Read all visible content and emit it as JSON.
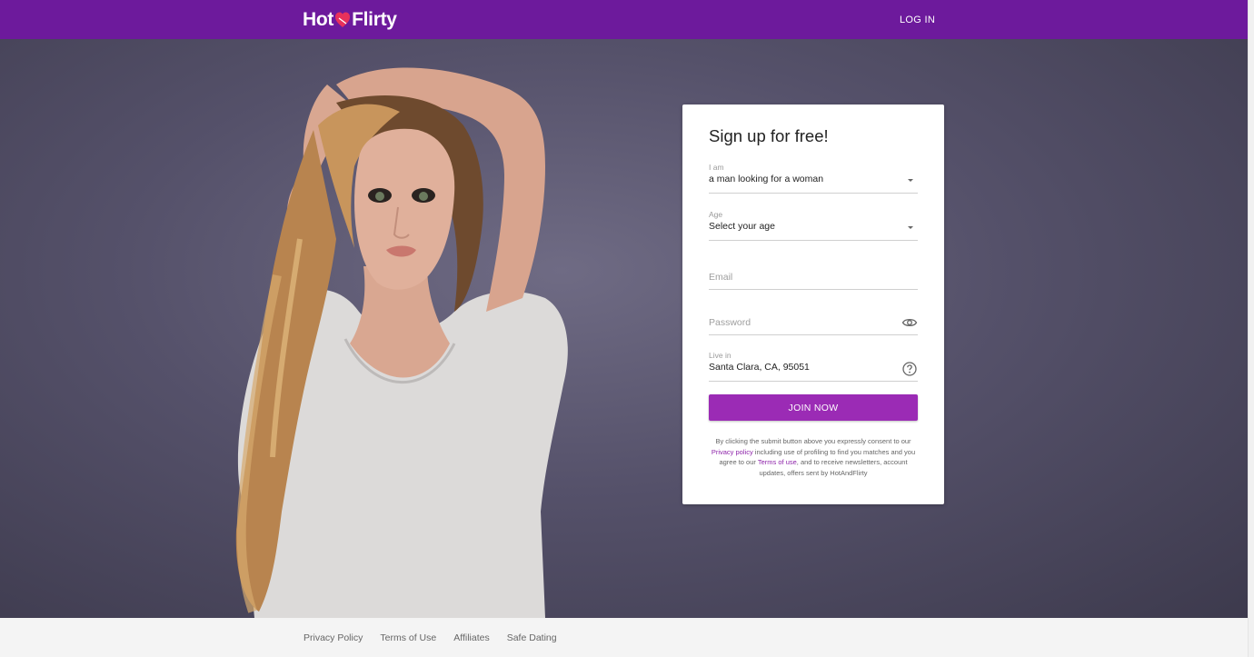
{
  "header": {
    "logo_left": "Hot",
    "logo_right": "Flirty",
    "login_label": "LOG IN",
    "color": "#6d1a9c"
  },
  "signup": {
    "title": "Sign up for free!",
    "iam_label": "I am",
    "iam_value": "a man looking for a woman",
    "age_label": "Age",
    "age_value": "Select your age",
    "email_placeholder": "Email",
    "password_placeholder": "Password",
    "livein_label": "Live in",
    "livein_value": "Santa Clara, CA, 95051",
    "join_label": "JOIN NOW",
    "button_color": "#9b2bb5",
    "legal": {
      "part1": "By clicking the submit button above you expressly consent to our ",
      "privacy_link": "Privacy policy",
      "part2": " including use of profiling to find you matches and you agree to our ",
      "terms_link": "Terms of use",
      "part3": ", and to receive newsletters, account updates, offers sent by HotAndFlirty"
    },
    "icons": [
      "caret-down",
      "caret-down",
      "eye",
      "help-circle"
    ]
  },
  "footer": {
    "links": [
      "Privacy Policy",
      "Terms of Use",
      "Affiliates",
      "Safe Dating"
    ]
  }
}
